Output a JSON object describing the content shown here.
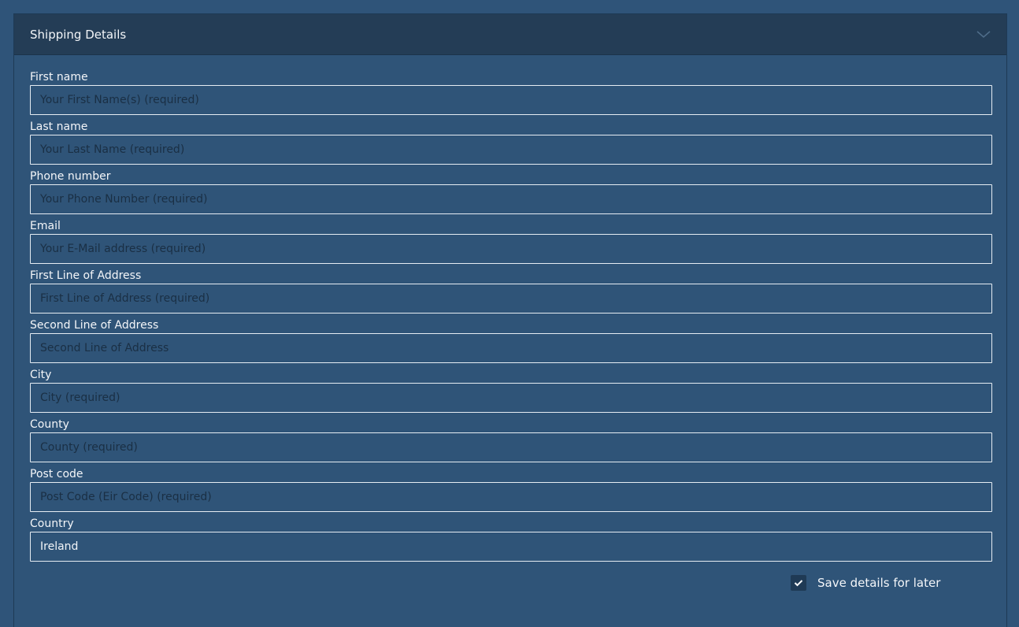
{
  "panel": {
    "title": "Shipping Details",
    "toggle_icon": "chevron-down-icon"
  },
  "fields": [
    {
      "label": "First name",
      "placeholder": "Your First Name(s) (required)",
      "value": ""
    },
    {
      "label": "Last name",
      "placeholder": "Your Last Name (required)",
      "value": ""
    },
    {
      "label": "Phone number",
      "placeholder": "Your Phone Number (required)",
      "value": ""
    },
    {
      "label": "Email",
      "placeholder": "Your E-Mail address (required)",
      "value": ""
    },
    {
      "label": "First Line of Address",
      "placeholder": "First Line of Address (required)",
      "value": ""
    },
    {
      "label": "Second Line of Address",
      "placeholder": "Second Line of Address",
      "value": ""
    },
    {
      "label": "City",
      "placeholder": "City (required)",
      "value": ""
    },
    {
      "label": "County",
      "placeholder": "County (required)",
      "value": ""
    },
    {
      "label": "Post code",
      "placeholder": "Post Code (Eir Code) (required)",
      "value": ""
    },
    {
      "label": "Country",
      "placeholder": "",
      "value": "Ireland"
    }
  ],
  "save": {
    "label": "Save details for later",
    "checked": true,
    "icon": "checkmark-icon"
  },
  "colors": {
    "background": "#2f5479",
    "header": "#243d56",
    "input_border": "#e6edf3",
    "checkbox_fill": "#1f3a55"
  }
}
